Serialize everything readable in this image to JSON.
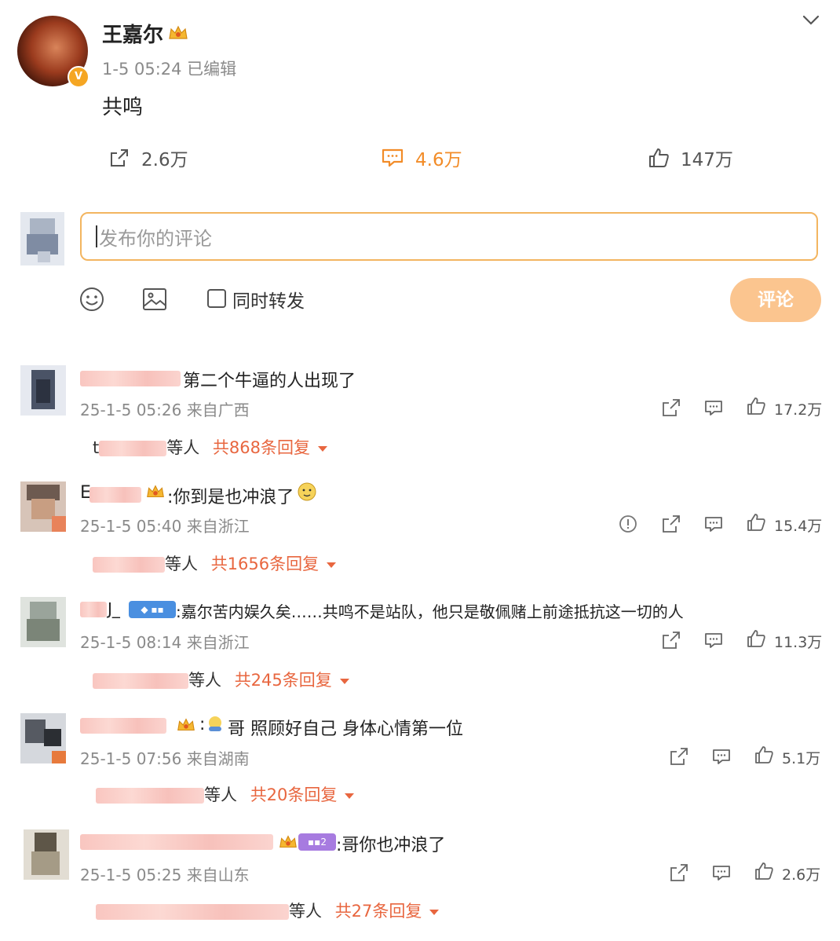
{
  "post": {
    "author": "王嘉尔",
    "meta": "1-5 05:24  已编辑",
    "content": "共鸣",
    "verified_badge": "V",
    "actions": {
      "repost": "2.6万",
      "comment": "4.6万",
      "like": "147万"
    },
    "accent_color": "#f28c28"
  },
  "compose": {
    "placeholder": "发布你的评论",
    "also_repost_label": "同时转发",
    "submit_label": "评论",
    "tools": [
      "emoji-icon",
      "image-icon"
    ]
  },
  "comments": [
    {
      "text": "第二个牛逼的人出现了",
      "time": "25-1-5 05:26",
      "location": "来自广西",
      "likes": "17.2万",
      "reply_who": "等人",
      "reply_count": "共868条回复",
      "reply_prefix": "t"
    },
    {
      "text": ":你到是也冲浪了",
      "time": "25-1-5 05:40",
      "location": "来自浙江",
      "likes": "15.4万",
      "reply_who": "等人",
      "reply_count": "共1656条回复",
      "name_prefix": "E"
    },
    {
      "text": ":嘉尔苦内娱久矣……共鸣不是站队，他只是敬佩赌上前途抵抗这一切的人",
      "time": "25-1-5 08:14",
      "location": "来自浙江",
      "likes": "11.3万",
      "reply_who": "等人",
      "reply_count": "共245条回复",
      "name_suffix": "J_"
    },
    {
      "text": "哥 照顾好自己 身体心情第一位",
      "time": "25-1-5 07:56",
      "location": "来自湖南",
      "likes": "5.1万",
      "reply_who": "等人",
      "reply_count": "共20条回复"
    },
    {
      "text": ":哥你也冲浪了",
      "time": "25-1-5 05:25",
      "location": "来自山东",
      "likes": "2.6万",
      "reply_who": "等人",
      "reply_count": "共27条回复"
    }
  ]
}
